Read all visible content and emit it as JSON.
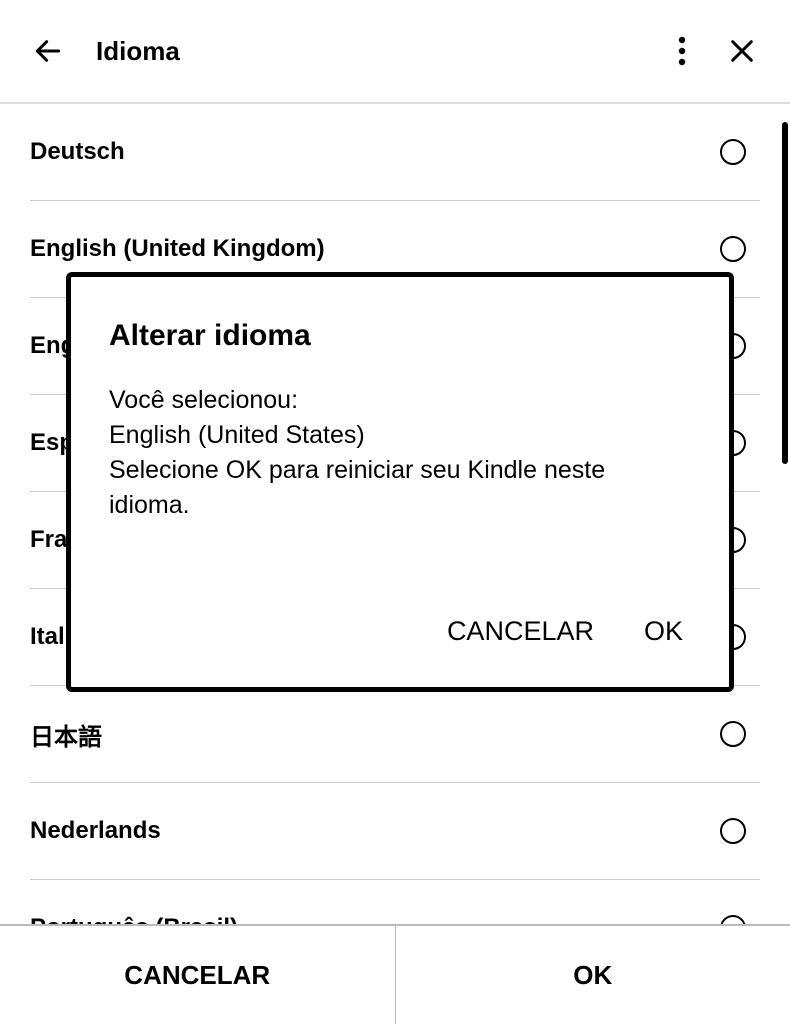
{
  "header": {
    "title": "Idioma"
  },
  "languages": [
    {
      "label": "Deutsch"
    },
    {
      "label": "English (United Kingdom)"
    },
    {
      "label": "English (United States)"
    },
    {
      "label": "Español"
    },
    {
      "label": "Français"
    },
    {
      "label": "Italiano"
    },
    {
      "label": "日本語"
    },
    {
      "label": "Nederlands"
    },
    {
      "label": "Português (Brasil)"
    }
  ],
  "footer": {
    "cancel": "CANCELAR",
    "ok": "OK"
  },
  "modal": {
    "title": "Alterar idioma",
    "line1": "Você selecionou:",
    "line2": "English (United States)",
    "line3": "Selecione OK para reiniciar seu Kindle neste idioma.",
    "cancel": "CANCELAR",
    "ok": "OK"
  }
}
